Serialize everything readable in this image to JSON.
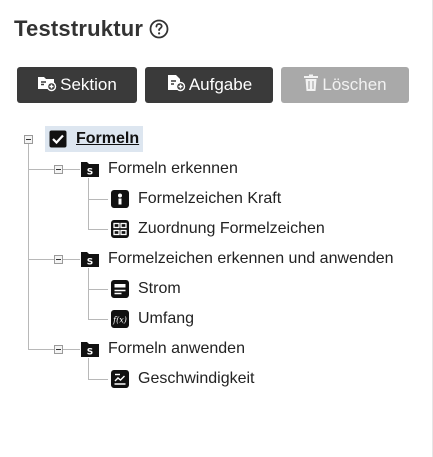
{
  "header": {
    "title": "Teststruktur",
    "help_icon": "question-circle-icon"
  },
  "toolbar": {
    "section_label": "Sektion",
    "section_icon": "folder-plus-icon",
    "task_label": "Aufgabe",
    "task_icon": "file-plus-icon",
    "delete_label": "Löschen",
    "delete_icon": "trash-icon"
  },
  "tree": {
    "root": {
      "label": "Formeln",
      "icon": "checkbox-checked-icon",
      "selected": true
    },
    "sections": [
      {
        "label": "Formeln erkennen",
        "icon": "section-folder-icon",
        "items": [
          {
            "label": "Formelzeichen Kraft",
            "icon": "info-card-icon"
          },
          {
            "label": "Zuordnung Formelzeichen",
            "icon": "grid-match-icon"
          }
        ]
      },
      {
        "label": "Formelzeichen erkennen und anwenden",
        "icon": "section-folder-icon",
        "items": [
          {
            "label": "Strom",
            "icon": "text-lines-icon"
          },
          {
            "label": "Umfang",
            "icon": "formula-fx-icon"
          }
        ]
      },
      {
        "label": "Formeln anwenden",
        "icon": "section-folder-icon",
        "items": [
          {
            "label": "Geschwindigkeit",
            "icon": "chart-card-icon"
          }
        ]
      }
    ]
  },
  "colors": {
    "button_dark": "#3a3a3a",
    "button_disabled": "#a9a9a9",
    "selection": "#dde6f0"
  }
}
